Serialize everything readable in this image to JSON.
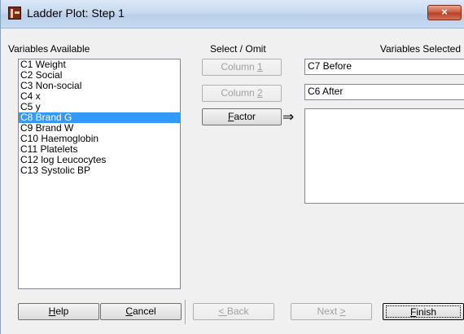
{
  "window": {
    "title": "Ladder Plot: Step 1",
    "close_label": "×"
  },
  "labels": {
    "variables_available": "Variables Available",
    "select_omit": "Select / Omit",
    "variables_selected": "Variables Selected"
  },
  "variables": [
    "C1 Weight",
    "C2 Social",
    "C3 Non-social",
    "C4 x",
    "C5 y",
    "C8 Brand G",
    "C9 Brand W",
    "C10 Haemoglobin",
    "C11 Platelets",
    "C12 log Leucocytes",
    "C13 Systolic BP"
  ],
  "selected_variable": "C8 Brand G",
  "buttons": {
    "column1_pre": "Column ",
    "column1_key": "1",
    "column2_pre": "Column ",
    "column2_key": "2",
    "factor_key": "F",
    "factor_rest": "actor",
    "help_key": "H",
    "help_rest": "elp",
    "cancel_key": "C",
    "cancel_rest": "ancel",
    "back_key": "< ",
    "back_rest": "Back",
    "next_pre": "Next ",
    "next_key": ">",
    "finish_key": "F",
    "finish_rest": "inish"
  },
  "fields": {
    "column1_value": "C7 Before",
    "column2_value": "C6 After",
    "factor_value": ""
  },
  "arrow_glyph": "⇒"
}
